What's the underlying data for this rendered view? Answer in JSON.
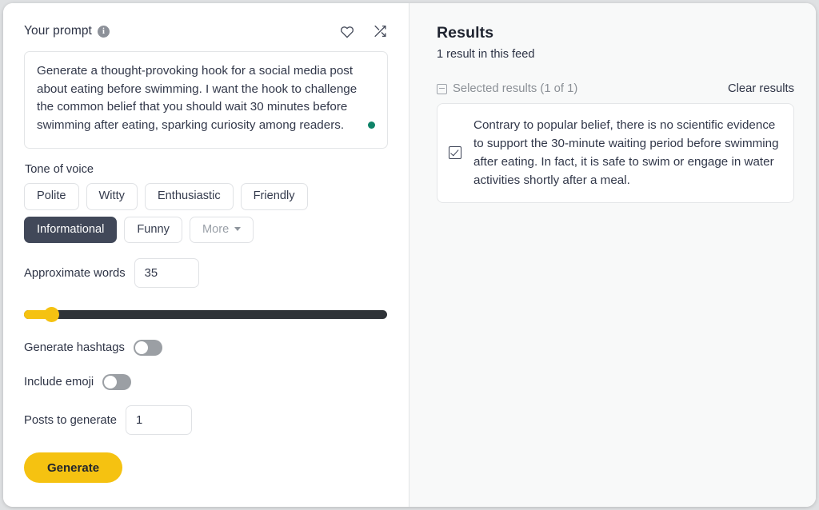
{
  "prompt_section": {
    "label": "Your prompt",
    "info_icon": "info-icon",
    "favorite_icon": "heart-icon",
    "shuffle_icon": "shuffle-icon",
    "text": "Generate a thought-provoking hook for a social media post about eating before swimming. I want the hook to challenge the common belief that you should wait 30 minutes before swimming after eating, sparking curiosity among readers.",
    "status_dot_color": "#0f8368"
  },
  "tone": {
    "label": "Tone of voice",
    "options": [
      {
        "label": "Polite",
        "active": false
      },
      {
        "label": "Witty",
        "active": false
      },
      {
        "label": "Enthusiastic",
        "active": false
      },
      {
        "label": "Friendly",
        "active": false
      },
      {
        "label": "Informational",
        "active": true
      },
      {
        "label": "Funny",
        "active": false
      }
    ],
    "more_label": "More",
    "active_color": "#414859"
  },
  "approximate_words": {
    "label": "Approximate words",
    "value": "35",
    "placeholder": ""
  },
  "slider": {
    "name": "creativity-slider",
    "value_percent": 6,
    "fill_color": "#f5c211",
    "track_color": "#2f3338"
  },
  "toggles": [
    {
      "label": "Generate hashtags",
      "on": false
    },
    {
      "label": "Include emoji",
      "on": false
    }
  ],
  "posts_to_generate": {
    "label": "Posts to generate",
    "value": "1",
    "placeholder": ""
  },
  "generate_button": {
    "label": "Generate",
    "color": "#f5c211"
  },
  "results": {
    "title": "Results",
    "subtitle": "1 result in this feed",
    "selected_label": "Selected results (1 of 1)",
    "clear_label": "Clear results",
    "items": [
      {
        "checked": true,
        "text": "Contrary to popular belief, there is no scientific evidence to support the 30-minute waiting period before swimming after eating. In fact, it is safe to swim or engage in water activities shortly after a meal."
      }
    ]
  }
}
